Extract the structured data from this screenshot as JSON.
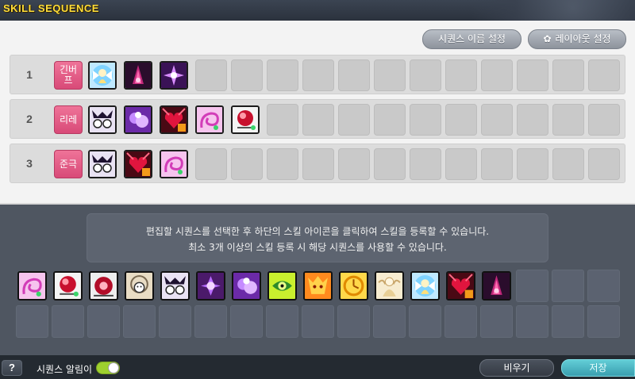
{
  "window": {
    "title": "SKILL SEQUENCE"
  },
  "buttons": {
    "rename": "시퀀스 이름 설정",
    "layout": "레이아웃 설정",
    "clear": "비우기",
    "save": "저장",
    "help": "?"
  },
  "sequences": [
    {
      "number": "1",
      "name": "긴버프",
      "skills": [
        "angel-buff",
        "flame-spire",
        "violet-star"
      ]
    },
    {
      "number": "2",
      "name": "리레",
      "skills": [
        "twin-ghost",
        "violet-cloud",
        "heart-burst",
        "pink-spiral",
        "red-orb"
      ]
    },
    {
      "number": "3",
      "name": "준극",
      "skills": [
        "twin-ghost",
        "heart-burst",
        "pink-spiral"
      ]
    }
  ],
  "notice": {
    "line1": "편집할 시퀀스를 선택한 후 하단의 스킬 아이콘을 클릭하여 스킬을 등록할 수 있습니다.",
    "line2": "최소 3개 이상의 스킬 등록 시 해당 시퀀스를 사용할 수 있습니다."
  },
  "skill_pool": [
    "pink-spiral",
    "red-orb",
    "red-orb-2",
    "sand-ghost",
    "twin-ghost",
    "violet-star-2",
    "violet-cloud",
    "green-eye",
    "orange-beast",
    "golden-clock",
    "cream-angel",
    "angel-buff",
    "heart-burst",
    "flame-spire"
  ],
  "footer": {
    "alarm_label": "시퀀스 알림이",
    "alarm_on": true
  },
  "colors": {
    "title": "#ffde3a",
    "sequence_name": "#e45c86",
    "save": "#4fb8c4",
    "toggle": "#9ed02e"
  }
}
